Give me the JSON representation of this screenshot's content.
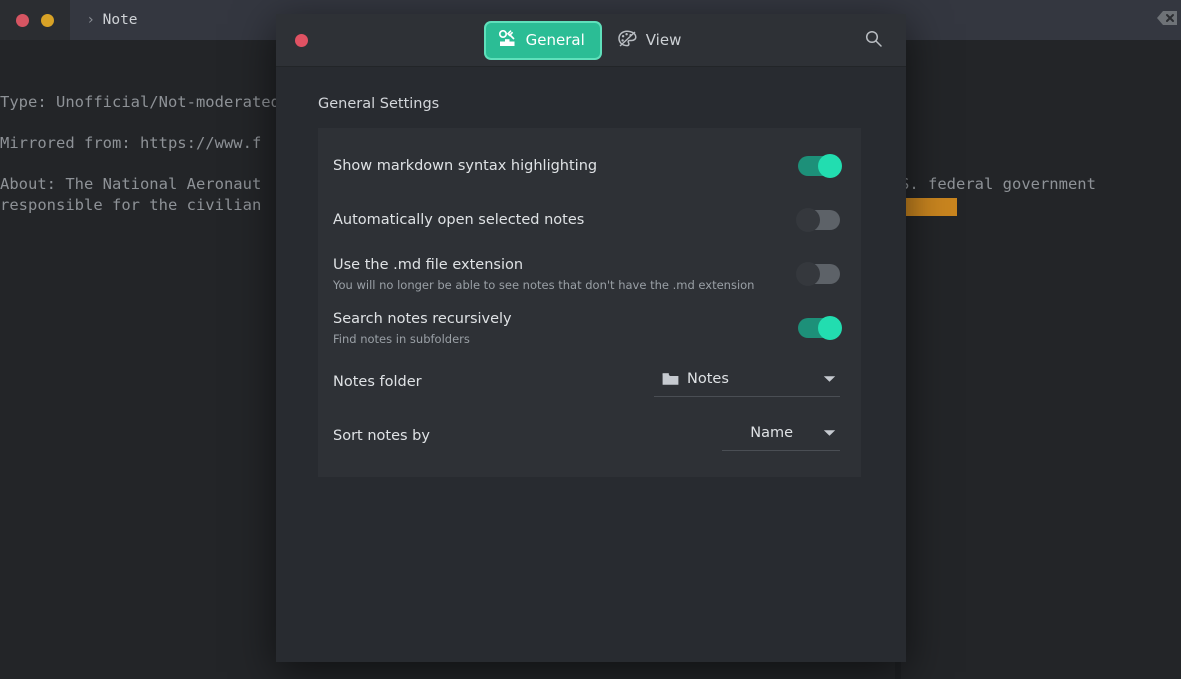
{
  "background_app": {
    "window_controls": [
      {
        "name": "close",
        "color": "#d65562"
      },
      {
        "name": "minimize",
        "color": "#d8a226"
      }
    ],
    "tab": {
      "chevron": "›",
      "label": "Note"
    },
    "toolbar": {
      "backspace_icon": "backspace-icon",
      "menu_icon": "hamburger-menu-icon"
    },
    "editor_lines": [
      "Type: Unofficial/Not-moderated",
      "",
      "Mirrored from: https://www.f",
      "",
      "About: The National Aeronautics and Space Administration is an independent agency of the U.S. federal government",
      "responsible for the civilian"
    ],
    "editor_right_fragments": [
      "S. federal government"
    ],
    "highlight_color": "#c9851f"
  },
  "dialog": {
    "close_button_color": "#e05263",
    "tabs": [
      {
        "id": "general",
        "label": "General",
        "icon": "settings-tools-icon",
        "active": true
      },
      {
        "id": "view",
        "label": "View",
        "icon": "palette-icon",
        "active": false
      }
    ],
    "search_icon": "search-icon",
    "accent_color": "#2bbd95",
    "section_title": "General Settings",
    "settings": [
      {
        "id": "markdown-syntax-highlighting",
        "label": "Show markdown syntax highlighting",
        "sub": "",
        "control": "toggle",
        "value": "on"
      },
      {
        "id": "auto-open-selected-notes",
        "label": "Automatically open selected notes",
        "sub": "",
        "control": "toggle",
        "value": "off"
      },
      {
        "id": "md-file-extension",
        "label": "Use the .md file extension",
        "sub": "You will no longer be able to see notes that don't have the .md extension",
        "control": "toggle",
        "value": "off"
      },
      {
        "id": "search-notes-recursively",
        "label": "Search notes recursively",
        "sub": "Find notes in subfolders",
        "control": "toggle",
        "value": "on"
      },
      {
        "id": "notes-folder",
        "label": "Notes folder",
        "sub": "",
        "control": "dropdown",
        "value": "Notes",
        "icon": "folder-icon"
      },
      {
        "id": "sort-notes-by",
        "label": "Sort notes by",
        "sub": "",
        "control": "dropdown",
        "value": "Name"
      }
    ]
  }
}
